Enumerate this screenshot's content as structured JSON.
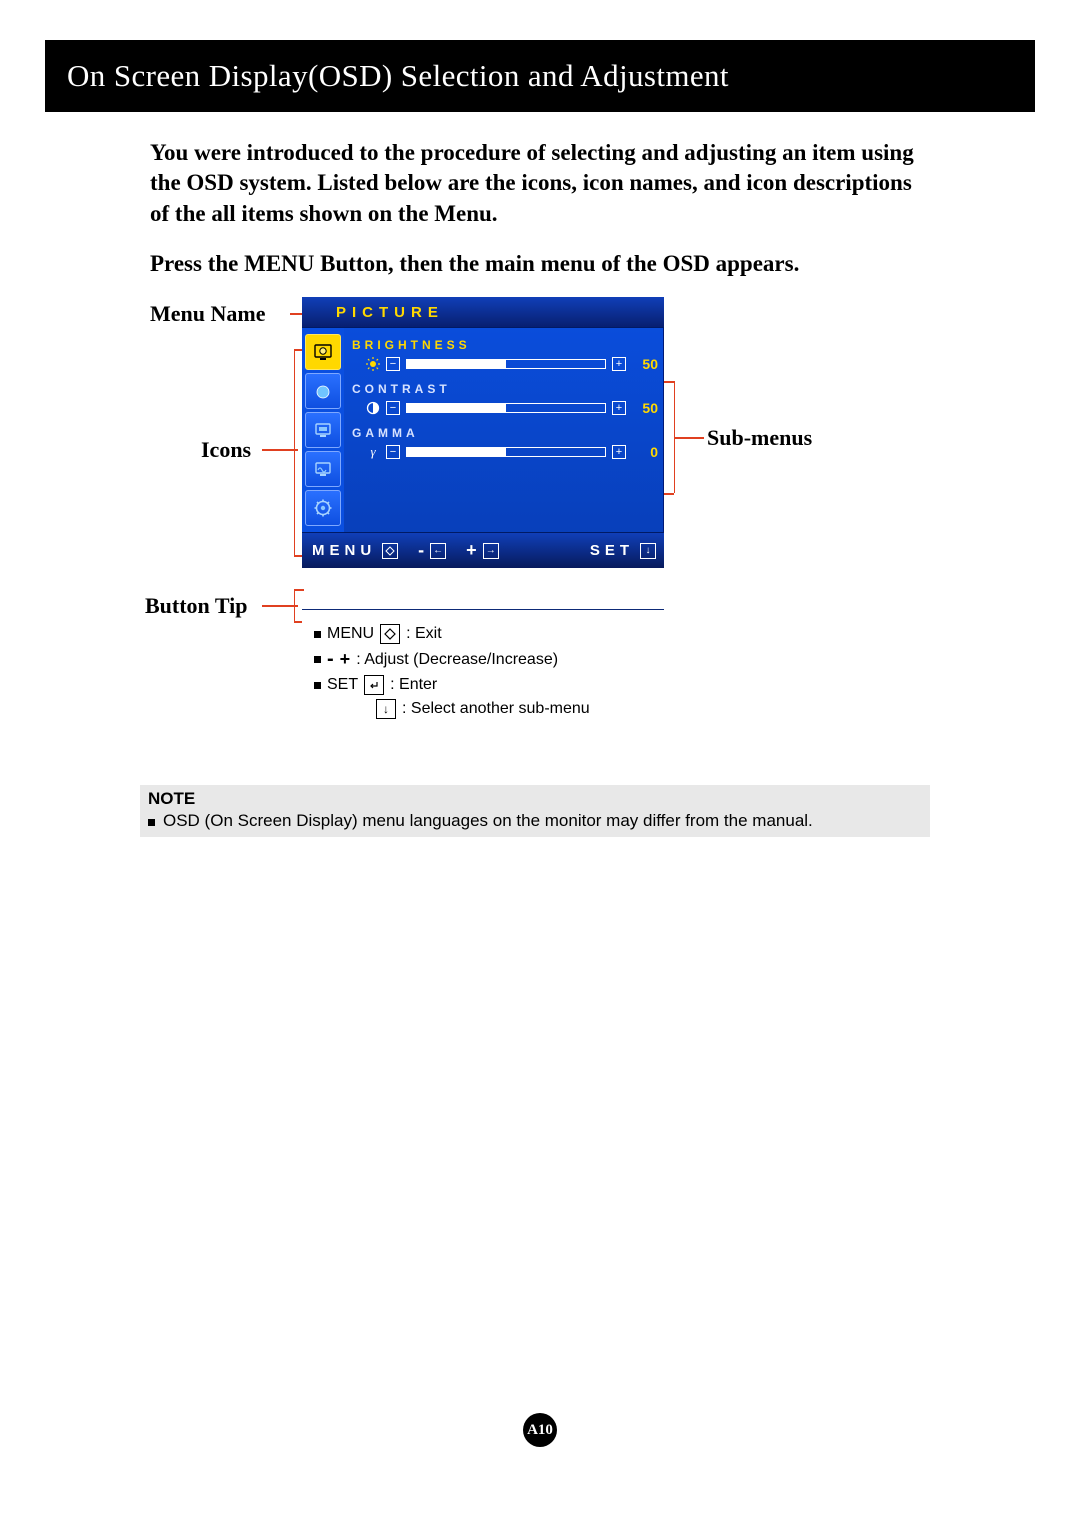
{
  "title": "On Screen Display(OSD) Selection and Adjustment",
  "intro": "You were introduced to the procedure of selecting and adjusting an item using the OSD system.  Listed below are the icons, icon names, and icon descriptions of the all items shown on the Menu.",
  "press_line": "Press the MENU Button, then the main menu of the OSD appears.",
  "labels": {
    "menu_name": "Menu Name",
    "icons": "Icons",
    "sub_menus": "Sub-menus",
    "button_tip": "Button Tip"
  },
  "osd": {
    "header": "PICTURE",
    "sub": [
      {
        "name": "BRIGHTNESS",
        "value": 50,
        "highlight": true
      },
      {
        "name": "CONTRAST",
        "value": 50,
        "highlight": false
      },
      {
        "name": "GAMMA",
        "value": 0,
        "highlight": false
      }
    ],
    "footer": {
      "menu": "MENU",
      "minus": "-",
      "plus": "+",
      "set": "SET"
    }
  },
  "tips": {
    "menu_label": "MENU",
    "menu_desc": ": Exit",
    "adjust_minus": "-",
    "adjust_plus": "+",
    "adjust_desc": ": Adjust (Decrease/Increase)",
    "set_label": "SET",
    "set_desc": ": Enter",
    "select_desc": ": Select another sub-menu"
  },
  "note": {
    "heading": "NOTE",
    "body": "OSD (On Screen Display) menu languages on the monitor may differ from the manual."
  },
  "page_number": "A10"
}
